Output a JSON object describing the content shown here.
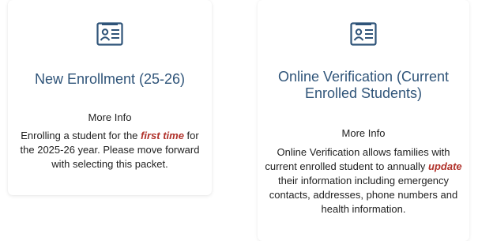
{
  "cards": [
    {
      "icon": "id-card-icon",
      "title": "New Enrollment (25-26)",
      "more_info": "More Info",
      "desc_before": "Enrolling a student for the ",
      "desc_emphasis": "first time",
      "desc_after": " for the 2025-26 year. Please move forward with selecting this packet."
    },
    {
      "icon": "id-card-icon",
      "title": "Online Verification (Current Enrolled Students)",
      "more_info": "More Info",
      "desc_before": "Online Verification allows families with current enrolled student to annually ",
      "desc_emphasis": "update",
      "desc_after": " their information including emergency contacts, addresses, phone numbers and health information."
    }
  ],
  "colors": {
    "title": "#2f5479",
    "icon": "#2f5479",
    "emphasis": "#b0312a"
  }
}
